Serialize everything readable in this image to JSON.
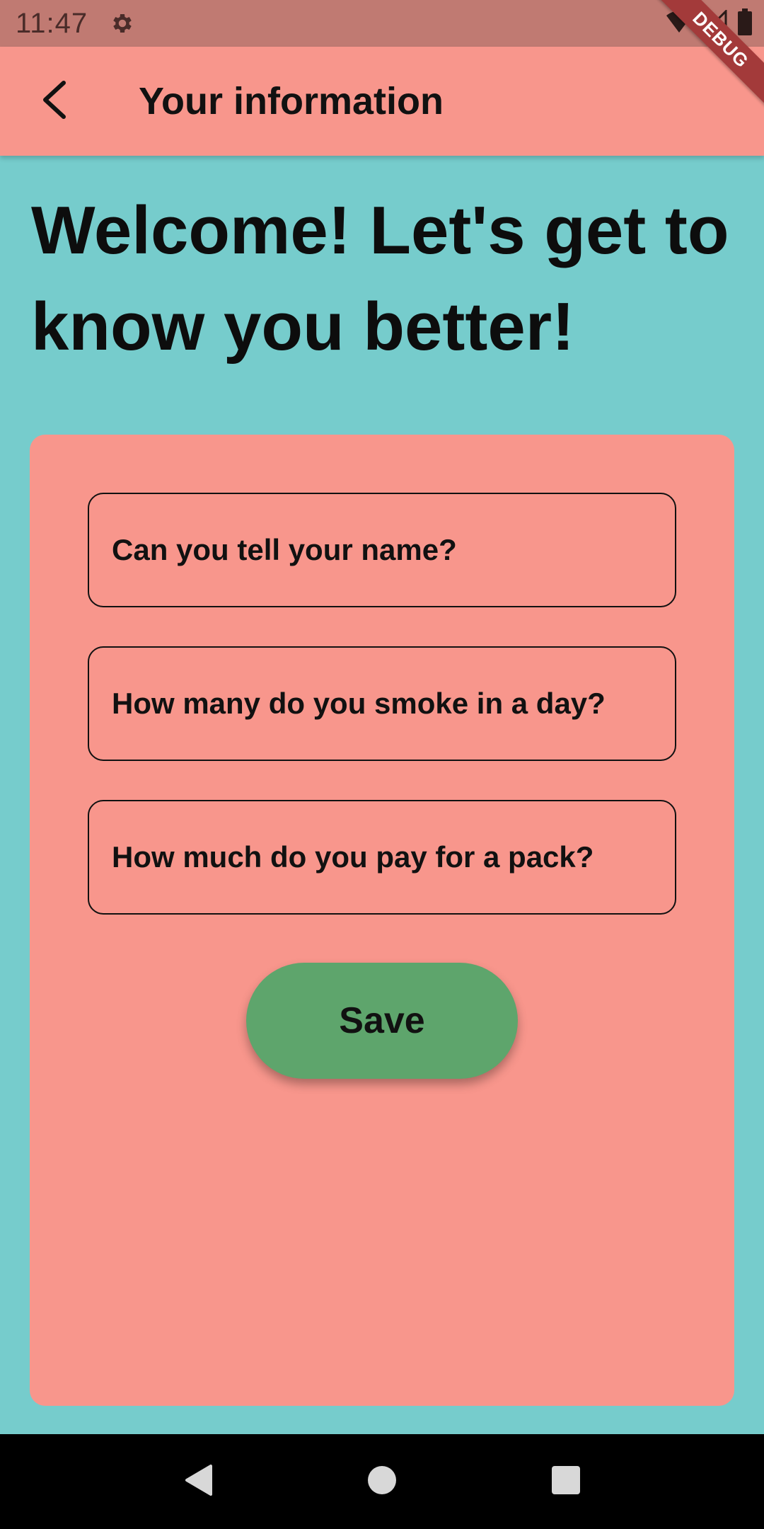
{
  "status_bar": {
    "time": "11:47",
    "icons": [
      "settings-gear-icon",
      "wifi-icon",
      "signal-icon",
      "battery-icon"
    ]
  },
  "debug_banner": {
    "label": "DEBUG"
  },
  "app_bar": {
    "back_icon": "chevron-left-icon",
    "title": "Your information"
  },
  "main": {
    "heading": "Welcome! Let's get to know you better!"
  },
  "form": {
    "fields": [
      {
        "label": "Can you tell your name?",
        "value": ""
      },
      {
        "label": "How many do you smoke in a day?",
        "value": ""
      },
      {
        "label": "How much do you pay for a pack?",
        "value": ""
      }
    ],
    "save_label": "Save"
  },
  "nav_bar": {
    "buttons": [
      "back-triangle-icon",
      "home-circle-icon",
      "recents-square-icon"
    ]
  },
  "colors": {
    "background": "#76cccc",
    "app_bar": "#f8968c",
    "card": "#f8968c",
    "save_button": "#5ea56c",
    "status_bar": "#c07a72",
    "debug_banner": "#a33a3a"
  }
}
